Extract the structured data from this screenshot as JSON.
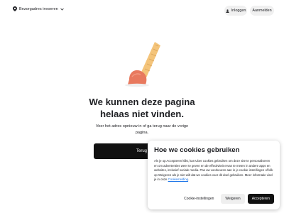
{
  "header": {
    "address_label": "Bezorgadres invoeren",
    "login_label": "Inloggen",
    "register_label": "Aanmelden"
  },
  "error": {
    "title_line1": "We kunnen deze pagina",
    "title_line2": "helaas niet vinden.",
    "subtitle": "Voer het adres opnieuw in of ga terug naar de vorige pagina.",
    "back_label": "Terug"
  },
  "cookie_banner": {
    "title": "Hoe we cookies gebruiken",
    "body": "Als je op Accepteren klikt, kan Uber cookies gebruiken om deze site te personaliseren en om advertenties weer te geven en de effectiviteit ervan te meten in andere apps en websites, inclusief sociale media. Pas uw voorkeuren aan in je cookie-instellingen of klik op Weigeren als je niet wilt dat we cookies voor dit doel gebruiken. Meer informatie vind je in onze",
    "link_text": "Cookiemelding",
    "settings_label": "Cookie-instellingen",
    "reject_label": "Weigeren",
    "accept_label": "Accepteren"
  },
  "colors": {
    "accent_dark": "#111111",
    "cone": "#f4c47a",
    "scoop": "#e8795e",
    "link": "#1a73e8"
  },
  "icons": {
    "address": "location-pin-icon",
    "chevron": "chevron-down-icon",
    "login": "person-icon"
  }
}
